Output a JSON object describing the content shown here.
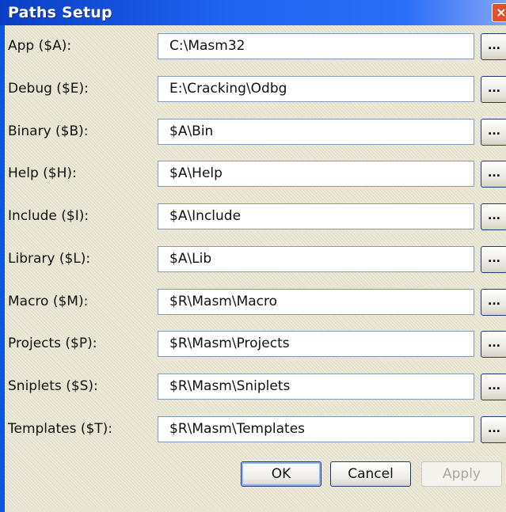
{
  "window": {
    "title": "Paths Setup",
    "close_label": "×"
  },
  "paths": [
    {
      "label": "App ($A):",
      "value": "C:\\Masm32"
    },
    {
      "label": "Debug ($E):",
      "value": "E:\\Cracking\\Odbg"
    },
    {
      "label": "Binary ($B):",
      "value": "$A\\Bin"
    },
    {
      "label": "Help ($H):",
      "value": "$A\\Help"
    },
    {
      "label": "Include ($I):",
      "value": "$A\\Include"
    },
    {
      "label": "Library ($L):",
      "value": "$A\\Lib"
    },
    {
      "label": "Macro ($M):",
      "value": "$R\\Masm\\Macro"
    },
    {
      "label": "Projects ($P):",
      "value": "$R\\Masm\\Projects"
    },
    {
      "label": "Sniplets ($S):",
      "value": "$R\\Masm\\Sniplets"
    },
    {
      "label": "Templates ($T):",
      "value": "$R\\Masm\\Templates"
    }
  ],
  "browse_label": "...",
  "buttons": {
    "ok": "OK",
    "cancel": "Cancel",
    "apply": "Apply"
  },
  "colors": {
    "titlebar": "#0a3fc4",
    "client": "#ece9d8",
    "close": "#e0522a"
  }
}
